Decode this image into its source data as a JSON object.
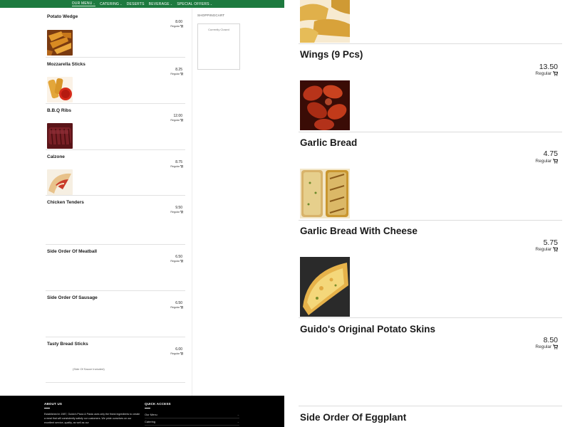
{
  "nav": {
    "items": [
      {
        "label": "OUR MENU",
        "has_dropdown": true
      },
      {
        "label": "CATERING",
        "has_dropdown": true
      },
      {
        "label": "DESERTS",
        "has_dropdown": false
      },
      {
        "label": "BEVERAGE",
        "has_dropdown": true
      },
      {
        "label": "SPECIAL OFFERS",
        "has_dropdown": true
      }
    ],
    "chevron": "⌄"
  },
  "menu_left": {
    "items": [
      {
        "name": "Potato Wedge",
        "price": "8.00",
        "size": "Regular",
        "image": "potato-wedge-photo"
      },
      {
        "name": "Mozzarella Sticks",
        "price": "8.25",
        "size": "Regular",
        "image": "mozzarella-sticks-photo"
      },
      {
        "name": "B.B.Q Ribs",
        "price": "12.00",
        "size": "Regular",
        "image": "bbq-ribs-photo"
      },
      {
        "name": "Calzone",
        "price": "8.75",
        "size": "Regular",
        "image": "calzone-photo"
      },
      {
        "name": "Chicken Tenders",
        "price": "9.50",
        "size": "Regular",
        "image": ""
      },
      {
        "name": "Side Order Of Meatball",
        "price": "6.50",
        "size": "Regular",
        "image": ""
      },
      {
        "name": "Side Order Of Sausage",
        "price": "6.50",
        "size": "Regular",
        "image": ""
      },
      {
        "name": "Tasty Bread Sticks",
        "price": "6.00",
        "size": "Regular",
        "image": "",
        "note": "(Side Of Sauce Included)"
      }
    ]
  },
  "cart": {
    "title": "SHOPPINGCART",
    "status": "Currently Closed"
  },
  "footer": {
    "about_title": "ABOUT US",
    "about_text": "Established in 1987, Guido's Pizza & Pasta uses only the finest ingredients to create a meal that will consistently satisfy our customers. We pride ourselves on our excellent service, quality, as well as our",
    "quick_title": "QUICK ACCESS",
    "quick_links": [
      "Our Menu",
      "Catering"
    ],
    "link_arrow": "→"
  },
  "menu_right": {
    "items": [
      {
        "name": "Wings (9 Pcs)",
        "price": "13.50",
        "size": "Regular",
        "image": "wings-photo"
      },
      {
        "name": "Garlic Bread",
        "price": "4.75",
        "size": "Regular",
        "image": "garlic-bread-photo"
      },
      {
        "name": "Garlic Bread With Cheese",
        "price": "5.75",
        "size": "Regular",
        "image": "garlic-bread-cheese-photo"
      },
      {
        "name": "Guido's Original Potato Skins",
        "price": "8.50",
        "size": "Regular",
        "image": ""
      },
      {
        "name": "Side Order Of Eggplant",
        "price": "",
        "size": "",
        "image": ""
      }
    ]
  },
  "colors": {
    "nav_green": "#1d7a3f",
    "footer_black": "#000000",
    "divider": "#dcdcdc"
  }
}
